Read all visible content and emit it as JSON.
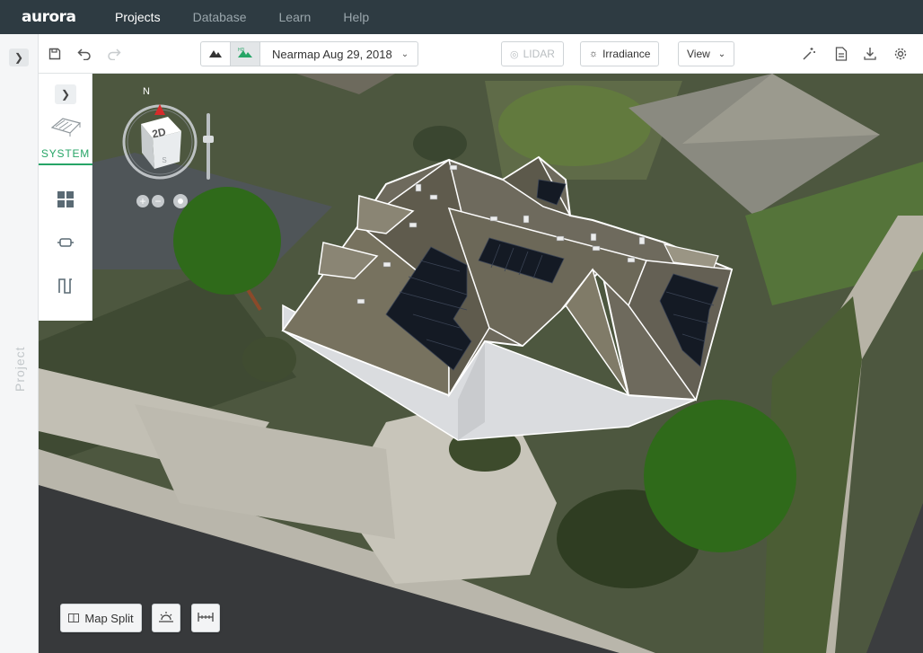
{
  "app": {
    "logo": "aurora"
  },
  "nav": {
    "items": [
      {
        "label": "Projects",
        "active": true
      },
      {
        "label": "Database",
        "active": false
      },
      {
        "label": "Learn",
        "active": false
      },
      {
        "label": "Help",
        "active": false
      }
    ]
  },
  "left_rail": {
    "toggle_icon": "chevron-right-icon",
    "label": "Project"
  },
  "toolbar": {
    "imagery_date": "Nearmap Aug 29, 2018",
    "lidar_label": "LIDAR",
    "irradiance_label": "Irradiance",
    "view_label": "View"
  },
  "side_panel": {
    "system_label": "SYSTEM",
    "tools": [
      "panels-icon",
      "component-icon",
      "wire-icon"
    ]
  },
  "compass": {
    "north_label": "N",
    "view_mode_label": "2D",
    "south_label": "S"
  },
  "bottom": {
    "map_split_label": "Map Split"
  },
  "colors": {
    "accent": "#27a567",
    "nav_bg": "#2e3b42",
    "tree": "#2f6a1a"
  }
}
